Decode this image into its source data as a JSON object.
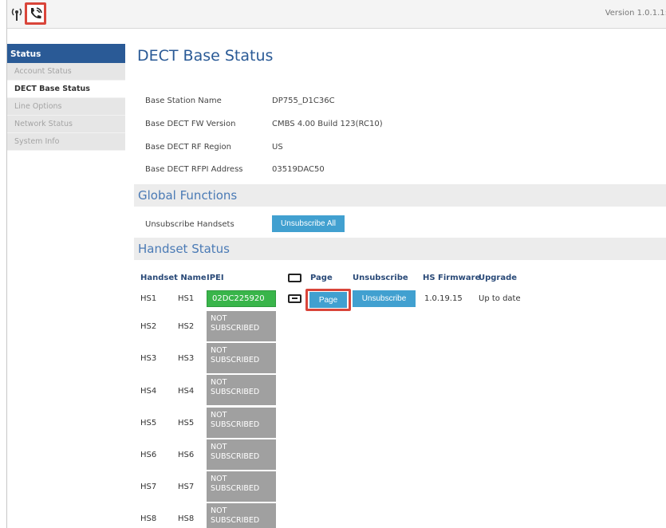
{
  "header": {
    "version": "Version 1.0.1.1:"
  },
  "sidebar": {
    "title": "Status",
    "items": [
      {
        "label": "Account Status"
      },
      {
        "label": "DECT Base Status"
      },
      {
        "label": "Line Options"
      },
      {
        "label": "Network Status"
      },
      {
        "label": "System Info"
      }
    ]
  },
  "main": {
    "title": "DECT Base Status",
    "info": [
      {
        "label": "Base Station Name",
        "value": "DP755_D1C36C"
      },
      {
        "label": "Base DECT FW Version",
        "value": "CMBS 4.00 Build 123(RC10)"
      },
      {
        "label": "Base DECT RF Region",
        "value": "US"
      },
      {
        "label": "Base DECT RFPI Address",
        "value": "03519DAC50"
      }
    ],
    "global": {
      "title": "Global Functions",
      "unsubscribe_label": "Unsubscribe Handsets",
      "unsubscribe_button": "Unsubscribe All"
    },
    "handset": {
      "title": "Handset Status",
      "headers": {
        "handset_name": "Handset Name",
        "ipei": "IPEI",
        "page": "Page",
        "unsubscribe": "Unsubscribe",
        "hs_firmware": "HS Firmware",
        "upgrade": "Upgrade"
      },
      "rows": [
        {
          "handset": "HS1",
          "name": "HS1",
          "ipei": "02DC225920",
          "page_button": "Page",
          "unsubscribe_button": "Unsubscribe",
          "firmware": "1.0.19.15",
          "upgrade": "Up to date"
        },
        {
          "handset": "HS2",
          "name": "HS2",
          "status_line1": "NOT",
          "status_line2": "SUBSCRIBED"
        },
        {
          "handset": "HS3",
          "name": "HS3",
          "status_line1": "NOT",
          "status_line2": "SUBSCRIBED"
        },
        {
          "handset": "HS4",
          "name": "HS4",
          "status_line1": "NOT",
          "status_line2": "SUBSCRIBED"
        },
        {
          "handset": "HS5",
          "name": "HS5",
          "status_line1": "NOT",
          "status_line2": "SUBSCRIBED"
        },
        {
          "handset": "HS6",
          "name": "HS6",
          "status_line1": "NOT",
          "status_line2": "SUBSCRIBED"
        },
        {
          "handset": "HS7",
          "name": "HS7",
          "status_line1": "NOT",
          "status_line2": "SUBSCRIBED"
        },
        {
          "handset": "HS8",
          "name": "HS8",
          "status_line1": "NOT",
          "status_line2": "SUBSCRIBED"
        }
      ]
    }
  },
  "colors": {
    "accent": "#2a5a96",
    "button": "#41a0d0",
    "subscribed": "#39b54a",
    "not_subscribed": "#a0a0a0",
    "highlight": "#d9453a"
  },
  "icons": [
    "antenna-icon",
    "phone-icon",
    "keyboard-icon",
    "page-icon"
  ]
}
